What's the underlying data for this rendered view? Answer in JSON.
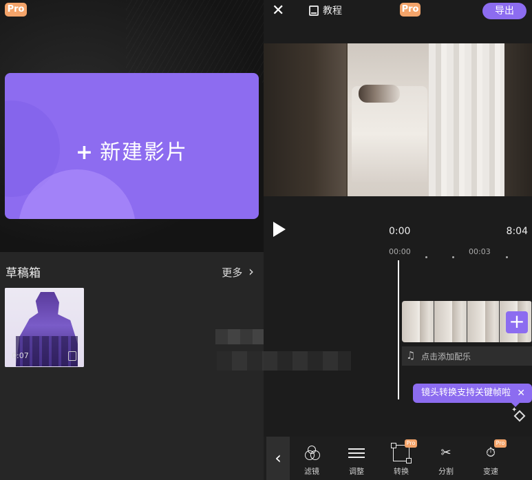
{
  "left": {
    "pro_badge": "Pro",
    "new_movie_label": "新建影片",
    "new_movie_plus": "+",
    "drafts_title": "草稿箱",
    "more_label": "更多",
    "more_chevron": "›",
    "draft": {
      "duration": "0:07"
    }
  },
  "right": {
    "header": {
      "close_symbol": "✕",
      "tutorial_label": "教程",
      "pro_badge": "Pro",
      "export_label": "导出"
    },
    "player": {
      "current_time": "0:00",
      "total_time": "8:04"
    },
    "ruler": {
      "ticks": [
        "00:00",
        "00:03"
      ]
    },
    "timeline": {
      "add_clip_symbol": "+",
      "music_note": "♫",
      "add_music_label": "点击添加配乐"
    },
    "tooltip": {
      "text": "镜头转换支持关键帧啦",
      "close_symbol": "✕"
    },
    "toolbar": {
      "back_symbol": "‹",
      "tools": [
        {
          "label": "滤镜",
          "icon": "filter-icon"
        },
        {
          "label": "调整",
          "icon": "adjust-icon"
        },
        {
          "label": "转换",
          "icon": "transform-icon",
          "badge": "Pro"
        },
        {
          "label": "分割",
          "icon": "scissors-icon"
        },
        {
          "label": "变速",
          "icon": "speed-icon",
          "badge": "Pro"
        }
      ]
    }
  },
  "colors": {
    "accent": "#8c6cf0",
    "pro_badge": "#f4a46a",
    "background": "#1c1c1c"
  }
}
